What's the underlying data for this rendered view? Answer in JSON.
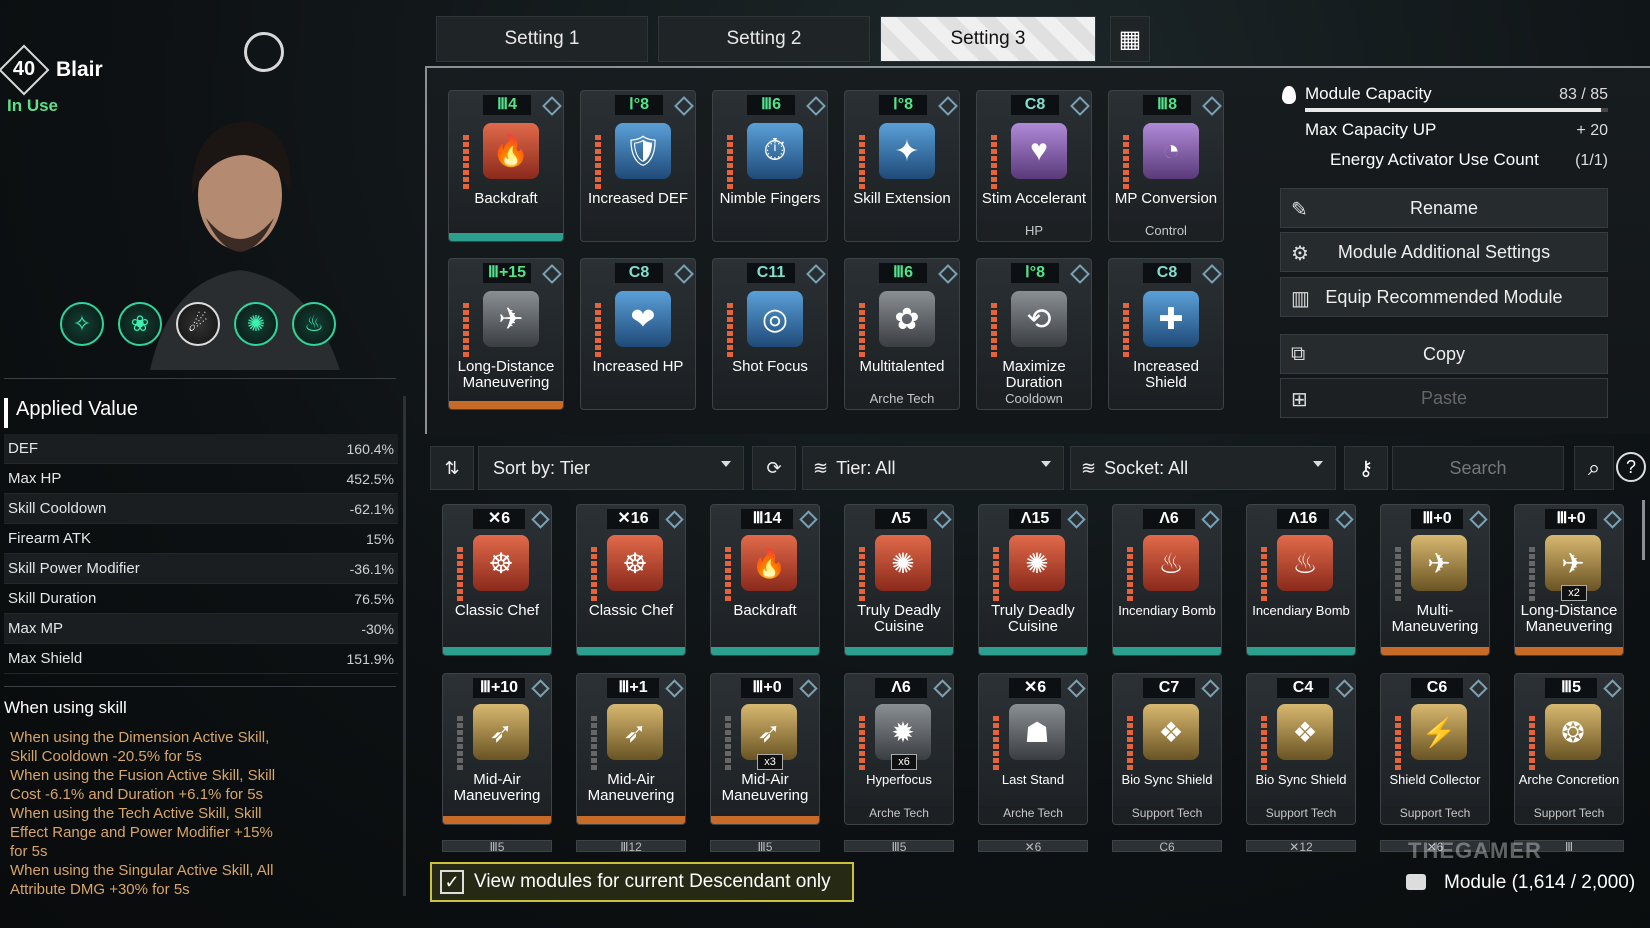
{
  "character": {
    "level": "40",
    "name": "Blair",
    "status": "In Use"
  },
  "applied_value": {
    "title": "Applied Value",
    "rows": [
      {
        "label": "DEF",
        "value": "160.4%"
      },
      {
        "label": "Max HP",
        "value": "452.5%"
      },
      {
        "label": "Skill Cooldown",
        "value": "-62.1%"
      },
      {
        "label": "Firearm ATK",
        "value": "15%"
      },
      {
        "label": "Skill Power Modifier",
        "value": "-36.1%"
      },
      {
        "label": "Skill Duration",
        "value": "76.5%"
      },
      {
        "label": "Max MP",
        "value": "-30%"
      },
      {
        "label": "Max Shield",
        "value": "151.9%"
      }
    ]
  },
  "when_using_skill": {
    "title": "When using skill",
    "lines": [
      "When using the Dimension Active Skill,",
      "Skill Cooldown -20.5% for 5s",
      "When using the Fusion Active Skill, Skill",
      "Cost -6.1% and Duration +6.1% for 5s",
      "When using the Tech Active Skill, Skill",
      "Effect Range and Power Modifier +15%",
      "for 5s",
      "When using the Singular Active Skill, All",
      "Attribute DMG +30% for 5s"
    ]
  },
  "tabs": [
    "Setting 1",
    "Setting 2",
    "Setting 3"
  ],
  "equipped": [
    {
      "cost": "Ⅲ4",
      "name": "Backdraft",
      "sub": "",
      "icon": "🔥",
      "color": "red"
    },
    {
      "cost": "Ⅰ°8",
      "name": "Increased DEF",
      "sub": "",
      "icon": "🛡",
      "color": "blue"
    },
    {
      "cost": "Ⅲ6",
      "name": "Nimble Fingers",
      "sub": "",
      "icon": "⏱",
      "color": "blue"
    },
    {
      "cost": "Ⅰ°8",
      "name": "Skill Extension",
      "sub": "",
      "icon": "✦",
      "color": "blue"
    },
    {
      "cost": "C8",
      "name": "Stim Accelerant",
      "sub": "HP",
      "icon": "♥",
      "color": "purple"
    },
    {
      "cost": "Ⅲ8",
      "name": "MP Conversion",
      "sub": "Control",
      "icon": "◔",
      "color": "purple"
    },
    {
      "cost": "Ⅲ+15",
      "name": "Long-Distance Maneuvering",
      "sub": "",
      "icon": "✈",
      "color": "gray"
    },
    {
      "cost": "C8",
      "name": "Increased HP",
      "sub": "",
      "icon": "❤",
      "color": "blue"
    },
    {
      "cost": "C11",
      "name": "Shot Focus",
      "sub": "",
      "icon": "◎",
      "color": "blue"
    },
    {
      "cost": "Ⅲ6",
      "name": "Multitalented",
      "sub": "Arche Tech",
      "icon": "✿",
      "color": "gray"
    },
    {
      "cost": "Ⅰ°8",
      "name": "Maximize Duration",
      "sub": "Cooldown",
      "icon": "⟲",
      "color": "gray"
    },
    {
      "cost": "C8",
      "name": "Increased Shield",
      "sub": "",
      "icon": "✚",
      "color": "blue"
    }
  ],
  "capacity": {
    "label": "Module Capacity",
    "value": "83 / 85",
    "fill": 0.976,
    "max_up_label": "Max Capacity UP",
    "max_up_value": "+ 20",
    "activator_label": "Energy Activator Use Count",
    "activator_value": "(1/1)"
  },
  "actions": {
    "rename": "Rename",
    "additional": "Module Additional Settings",
    "recommend": "Equip Recommended Module",
    "copy": "Copy",
    "paste": "Paste"
  },
  "filters": {
    "sort": "Sort by: Tier",
    "tier": "Tier: All",
    "socket": "Socket: All",
    "search_placeholder": "Search"
  },
  "modules": [
    {
      "cost": "✕6",
      "name": "Classic Chef",
      "sub": "",
      "mult": "",
      "icon": "☸",
      "color": "red",
      "glow": "teal"
    },
    {
      "cost": "✕16",
      "name": "Classic Chef",
      "sub": "",
      "mult": "",
      "icon": "☸",
      "color": "red",
      "glow": "teal"
    },
    {
      "cost": "Ⅲ14",
      "name": "Backdraft",
      "sub": "",
      "mult": "",
      "icon": "🔥",
      "color": "red",
      "glow": "teal"
    },
    {
      "cost": "Λ5",
      "name": "Truly Deadly Cuisine",
      "sub": "",
      "mult": "",
      "icon": "✺",
      "color": "red",
      "glow": "teal"
    },
    {
      "cost": "Λ15",
      "name": "Truly Deadly Cuisine",
      "sub": "",
      "mult": "",
      "icon": "✺",
      "color": "red",
      "glow": "teal"
    },
    {
      "cost": "Λ6",
      "name": "Incendiary Bomb",
      "sub": "",
      "mult": "",
      "icon": "♨",
      "color": "red",
      "glow": "teal"
    },
    {
      "cost": "Λ16",
      "name": "Incendiary Bomb",
      "sub": "",
      "mult": "",
      "icon": "♨",
      "color": "red",
      "glow": "teal"
    },
    {
      "cost": "Ⅲ+0",
      "name": "Multi-Maneuvering",
      "sub": "",
      "mult": "",
      "icon": "✈",
      "color": "gold",
      "glow": "orange"
    },
    {
      "cost": "Ⅲ+0",
      "name": "Long-Distance Maneuvering",
      "sub": "",
      "mult": "x2",
      "icon": "✈",
      "color": "gold",
      "glow": "orange"
    },
    {
      "cost": "Ⅲ+10",
      "name": "Mid-Air Maneuvering",
      "sub": "",
      "mult": "",
      "icon": "➶",
      "color": "gold",
      "glow": "orange"
    },
    {
      "cost": "Ⅲ+1",
      "name": "Mid-Air Maneuvering",
      "sub": "",
      "mult": "",
      "icon": "➶",
      "color": "gold",
      "glow": "orange"
    },
    {
      "cost": "Ⅲ+0",
      "name": "Mid-Air Maneuvering",
      "sub": "",
      "mult": "x3",
      "icon": "➶",
      "color": "gold",
      "glow": "orange"
    },
    {
      "cost": "Λ6",
      "name": "Hyperfocus",
      "sub": "Arche Tech",
      "mult": "x6",
      "icon": "✹",
      "color": "gray",
      "glow": ""
    },
    {
      "cost": "✕6",
      "name": "Last Stand",
      "sub": "Arche Tech",
      "mult": "",
      "icon": "☗",
      "color": "gray",
      "glow": ""
    },
    {
      "cost": "C7",
      "name": "Bio Sync Shield",
      "sub": "Support Tech",
      "mult": "",
      "icon": "❖",
      "color": "gold",
      "glow": ""
    },
    {
      "cost": "C4",
      "name": "Bio Sync Shield",
      "sub": "Support Tech",
      "mult": "",
      "icon": "❖",
      "color": "gold",
      "glow": ""
    },
    {
      "cost": "C6",
      "name": "Shield Collector",
      "sub": "Support Tech",
      "mult": "",
      "icon": "⚡",
      "color": "gold",
      "glow": ""
    },
    {
      "cost": "Ⅲ5",
      "name": "Arche Concretion",
      "sub": "Support Tech",
      "mult": "",
      "icon": "❂",
      "color": "gold",
      "glow": ""
    }
  ],
  "partial_row": [
    "Ⅲ5",
    "Ⅲ12",
    "Ⅲ5",
    "Ⅲ5",
    "✕6",
    "C6",
    "✕12",
    "✕6",
    "Ⅲ"
  ],
  "view_current_only": "View modules for current Descendant only",
  "module_count": "Module (1,614 / 2,000)",
  "watermark": "THEGAMER"
}
